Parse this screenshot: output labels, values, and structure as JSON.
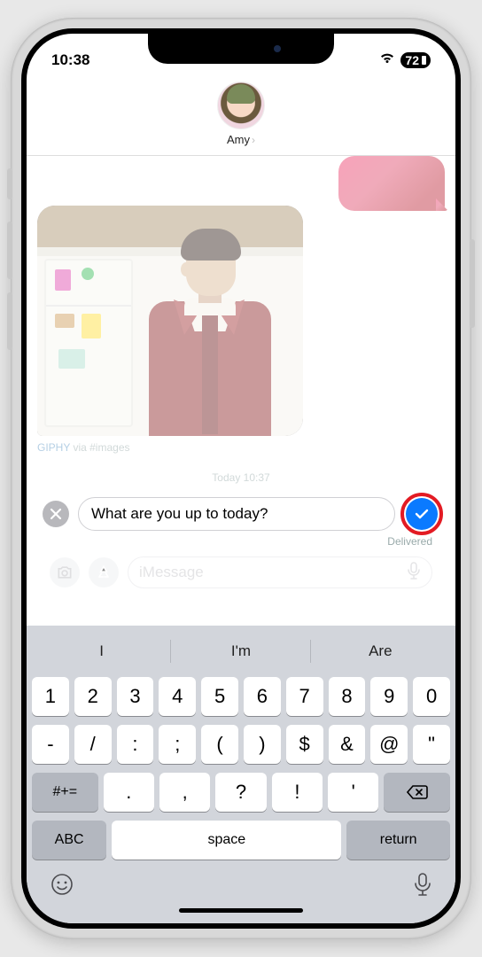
{
  "status": {
    "time": "10:38",
    "battery": "72"
  },
  "header": {
    "contact_name": "Amy"
  },
  "chat": {
    "gif_source": "GIPHY",
    "gif_via": " via #images",
    "timestamp": "Today 10:37",
    "edit_text": "What are you up to today?",
    "delivered_label": "Delivered",
    "compose_placeholder": "iMessage"
  },
  "suggestions": [
    "I",
    "I'm",
    "Are"
  ],
  "keyboard": {
    "row1": [
      "1",
      "2",
      "3",
      "4",
      "5",
      "6",
      "7",
      "8",
      "9",
      "0"
    ],
    "row2": [
      "-",
      "/",
      ":",
      ";",
      "(",
      ")",
      "$",
      "&",
      "@",
      "\""
    ],
    "row3_fn": "#+=",
    "row3": [
      ".",
      ",",
      "?",
      "!",
      "'"
    ],
    "abc": "ABC",
    "space": "space",
    "return": "return"
  }
}
